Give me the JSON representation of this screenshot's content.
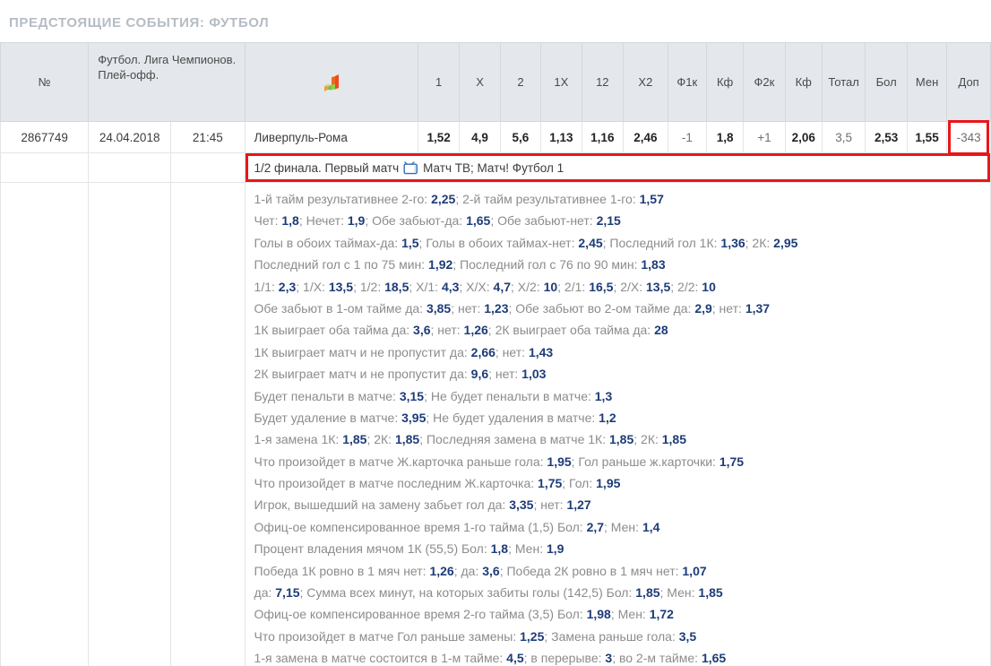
{
  "page": {
    "title": "ПРЕДСТОЯЩИЕ СОБЫТИЯ: ФУТБОЛ",
    "accent_red": "#e8161a",
    "odds_blue": "#1d3c78",
    "header_bg": "#e4e8ec"
  },
  "table": {
    "headers": {
      "number": "№",
      "league": "Футбол. Лига Чемпионов. Плей-офф.",
      "chart_icon": "bar-chart-icon",
      "c1": "1",
      "cx": "X",
      "c2": "2",
      "c1x": "1Х",
      "c12": "12",
      "cx2": "Х2",
      "f1k": "Ф1к",
      "kf1": "Кф",
      "f2k": "Ф2к",
      "kf2": "Кф",
      "total": "Тотал",
      "bol": "Бол",
      "men": "Мен",
      "dop": "Доп"
    },
    "row": {
      "number": "2867749",
      "date": "24.04.2018",
      "time": "21:45",
      "teams": "Ливерпуль-Рома",
      "c1": "1,52",
      "cx": "4,9",
      "c2": "5,6",
      "c1x": "1,13",
      "c12": "1,16",
      "cx2": "2,46",
      "f1k": "-1",
      "kf1": "1,8",
      "f2k": "+1",
      "kf2": "2,06",
      "total": "3,5",
      "bol": "2,53",
      "men": "1,55",
      "dop": "-343"
    },
    "info": {
      "stage": "1/2 финала. Первый матч",
      "tv_icon": "tv-icon",
      "channels": "Матч ТВ; Матч! Футбол 1"
    }
  },
  "details": [
    {
      "parts": [
        {
          "t": "1-й тайм результативнее 2-го: ",
          "b": false
        },
        {
          "t": "2,25",
          "b": true
        },
        {
          "t": "; ",
          "b": false
        },
        {
          "t": "2-й тайм результативнее 1-го: ",
          "b": false
        },
        {
          "t": "1,57",
          "b": true
        }
      ]
    },
    {
      "parts": [
        {
          "t": "Чет: ",
          "b": false
        },
        {
          "t": "1,8",
          "b": true
        },
        {
          "t": "; Нечет: ",
          "b": false
        },
        {
          "t": "1,9",
          "b": true
        },
        {
          "t": "; Обе забьют-да: ",
          "b": false
        },
        {
          "t": "1,65",
          "b": true
        },
        {
          "t": "; Обе забьют-нет: ",
          "b": false
        },
        {
          "t": "2,15",
          "b": true
        }
      ]
    },
    {
      "parts": [
        {
          "t": "Голы в обоих таймах-да: ",
          "b": false
        },
        {
          "t": "1,5",
          "b": true
        },
        {
          "t": "; Голы в обоих таймах-нет: ",
          "b": false
        },
        {
          "t": "2,45",
          "b": true
        },
        {
          "t": "; Последний гол 1К: ",
          "b": false
        },
        {
          "t": "1,36",
          "b": true
        },
        {
          "t": "; 2К: ",
          "b": false
        },
        {
          "t": "2,95",
          "b": true
        }
      ]
    },
    {
      "parts": [
        {
          "t": "Последний гол с 1 по 75 мин: ",
          "b": false
        },
        {
          "t": "1,92",
          "b": true
        },
        {
          "t": "; Последний гол с 76 по 90 мин: ",
          "b": false
        },
        {
          "t": "1,83",
          "b": true
        }
      ]
    },
    {
      "parts": [
        {
          "t": "1/1: ",
          "b": false
        },
        {
          "t": "2,3",
          "b": true
        },
        {
          "t": "; 1/Х: ",
          "b": false
        },
        {
          "t": "13,5",
          "b": true
        },
        {
          "t": "; 1/2: ",
          "b": false
        },
        {
          "t": "18,5",
          "b": true
        },
        {
          "t": "; Х/1: ",
          "b": false
        },
        {
          "t": "4,3",
          "b": true
        },
        {
          "t": "; Х/Х: ",
          "b": false
        },
        {
          "t": "4,7",
          "b": true
        },
        {
          "t": "; Х/2: ",
          "b": false
        },
        {
          "t": "10",
          "b": true
        },
        {
          "t": "; 2/1: ",
          "b": false
        },
        {
          "t": "16,5",
          "b": true
        },
        {
          "t": "; 2/Х: ",
          "b": false
        },
        {
          "t": "13,5",
          "b": true
        },
        {
          "t": "; 2/2: ",
          "b": false
        },
        {
          "t": "10",
          "b": true
        }
      ]
    },
    {
      "parts": [
        {
          "t": "Обе забьют в 1-ом тайме да: ",
          "b": false
        },
        {
          "t": "3,85",
          "b": true
        },
        {
          "t": "; нет: ",
          "b": false
        },
        {
          "t": "1,23",
          "b": true
        },
        {
          "t": "; Обе забьют во 2-ом тайме да: ",
          "b": false
        },
        {
          "t": "2,9",
          "b": true
        },
        {
          "t": "; нет: ",
          "b": false
        },
        {
          "t": "1,37",
          "b": true
        }
      ]
    },
    {
      "parts": [
        {
          "t": "1К выиграет оба тайма да: ",
          "b": false
        },
        {
          "t": "3,6",
          "b": true
        },
        {
          "t": "; нет: ",
          "b": false
        },
        {
          "t": "1,26",
          "b": true
        },
        {
          "t": "; 2К выиграет оба тайма да: ",
          "b": false
        },
        {
          "t": "28",
          "b": true
        }
      ]
    },
    {
      "parts": [
        {
          "t": "1К выиграет матч и не пропустит да: ",
          "b": false
        },
        {
          "t": "2,66",
          "b": true
        },
        {
          "t": "; нет: ",
          "b": false
        },
        {
          "t": "1,43",
          "b": true
        }
      ]
    },
    {
      "parts": [
        {
          "t": "2К выиграет матч и не пропустит да: ",
          "b": false
        },
        {
          "t": "9,6",
          "b": true
        },
        {
          "t": "; нет: ",
          "b": false
        },
        {
          "t": "1,03",
          "b": true
        }
      ]
    },
    {
      "parts": [
        {
          "t": "Будет пенальти в матче: ",
          "b": false
        },
        {
          "t": "3,15",
          "b": true
        },
        {
          "t": "; Не будет пенальти в матче: ",
          "b": false
        },
        {
          "t": "1,3",
          "b": true
        }
      ]
    },
    {
      "parts": [
        {
          "t": "Будет удаление в матче: ",
          "b": false
        },
        {
          "t": "3,95",
          "b": true
        },
        {
          "t": "; Не будет удаления в матче: ",
          "b": false
        },
        {
          "t": "1,2",
          "b": true
        }
      ]
    },
    {
      "parts": [
        {
          "t": "1-я замена 1К: ",
          "b": false
        },
        {
          "t": "1,85",
          "b": true
        },
        {
          "t": "; 2К: ",
          "b": false
        },
        {
          "t": "1,85",
          "b": true
        },
        {
          "t": "; Последняя замена в матче 1К: ",
          "b": false
        },
        {
          "t": "1,85",
          "b": true
        },
        {
          "t": "; 2К: ",
          "b": false
        },
        {
          "t": "1,85",
          "b": true
        }
      ]
    },
    {
      "parts": [
        {
          "t": "Что произойдет в матче Ж.карточка раньше гола: ",
          "b": false
        },
        {
          "t": "1,95",
          "b": true
        },
        {
          "t": "; Гол раньше ж.карточки: ",
          "b": false
        },
        {
          "t": "1,75",
          "b": true
        }
      ]
    },
    {
      "parts": [
        {
          "t": "Что произойдет в матче последним Ж.карточка: ",
          "b": false
        },
        {
          "t": "1,75",
          "b": true
        },
        {
          "t": "; Гол: ",
          "b": false
        },
        {
          "t": "1,95",
          "b": true
        }
      ]
    },
    {
      "parts": [
        {
          "t": "Игрок, вышедший на замену забьет гол да: ",
          "b": false
        },
        {
          "t": "3,35",
          "b": true
        },
        {
          "t": "; нет: ",
          "b": false
        },
        {
          "t": "1,27",
          "b": true
        }
      ]
    },
    {
      "parts": [
        {
          "t": "Офиц-ое компенсированное время 1-го тайма (1,5) Бол: ",
          "b": false
        },
        {
          "t": "2,7",
          "b": true
        },
        {
          "t": "; Мен: ",
          "b": false
        },
        {
          "t": "1,4",
          "b": true
        }
      ]
    },
    {
      "parts": [
        {
          "t": "Процент владения мячом 1К (55,5) Бол: ",
          "b": false
        },
        {
          "t": "1,8",
          "b": true
        },
        {
          "t": "; Мен: ",
          "b": false
        },
        {
          "t": "1,9",
          "b": true
        }
      ]
    },
    {
      "parts": [
        {
          "t": "Победа 1К ровно в 1 мяч нет: ",
          "b": false
        },
        {
          "t": "1,26",
          "b": true
        },
        {
          "t": "; да: ",
          "b": false
        },
        {
          "t": "3,6",
          "b": true
        },
        {
          "t": "; Победа 2К ровно в 1 мяч нет: ",
          "b": false
        },
        {
          "t": "1,07",
          "b": true
        }
      ]
    },
    {
      "parts": [
        {
          "t": "да: ",
          "b": false
        },
        {
          "t": "7,15",
          "b": true
        },
        {
          "t": "; Сумма всех минут, на которых забиты голы (142,5) Бол: ",
          "b": false
        },
        {
          "t": "1,85",
          "b": true
        },
        {
          "t": "; Мен: ",
          "b": false
        },
        {
          "t": "1,85",
          "b": true
        }
      ]
    },
    {
      "parts": [
        {
          "t": "Офиц-ое компенсированное время 2-го тайма (3,5) Бол: ",
          "b": false
        },
        {
          "t": "1,98",
          "b": true
        },
        {
          "t": "; Мен: ",
          "b": false
        },
        {
          "t": "1,72",
          "b": true
        }
      ]
    },
    {
      "parts": [
        {
          "t": "Что произойдет в матче Гол раньше замены: ",
          "b": false
        },
        {
          "t": "1,25",
          "b": true
        },
        {
          "t": "; Замена раньше гола: ",
          "b": false
        },
        {
          "t": "3,5",
          "b": true
        }
      ]
    },
    {
      "parts": [
        {
          "t": "1-я замена в матче состоится в 1-м тайме: ",
          "b": false
        },
        {
          "t": "4,5",
          "b": true
        },
        {
          "t": "; в перерыве: ",
          "b": false
        },
        {
          "t": "3",
          "b": true
        },
        {
          "t": "; во 2-м тайме: ",
          "b": false
        },
        {
          "t": "1,65",
          "b": true
        }
      ]
    }
  ]
}
